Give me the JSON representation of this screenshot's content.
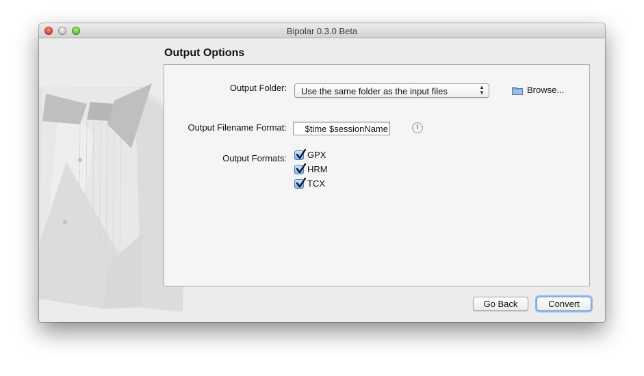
{
  "window": {
    "title": "Bipolar 0.3.0 Beta"
  },
  "page": {
    "heading": "Output Options"
  },
  "output_folder": {
    "label": "Output Folder:",
    "selected": "Use the same folder as the input files",
    "browse_label": "Browse..."
  },
  "filename_format": {
    "label": "Output Filename Format:",
    "value": "$time $sessionName"
  },
  "formats": {
    "label": "Output Formats:",
    "items": [
      {
        "label": "GPX",
        "checked": true
      },
      {
        "label": "HRM",
        "checked": true
      },
      {
        "label": "TCX",
        "checked": true
      }
    ]
  },
  "buttons": {
    "back": "Go Back",
    "convert": "Convert"
  },
  "colors": {
    "accent": "#6a98d0",
    "checkbox_fill": "#7fb3ea"
  },
  "icons": {
    "folder": "folder-icon",
    "info": "info-icon",
    "select_arrows": "updown-arrows-icon"
  }
}
